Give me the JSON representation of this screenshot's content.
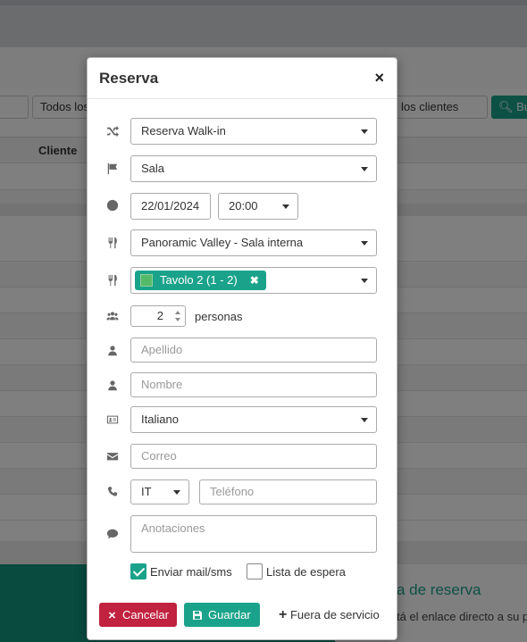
{
  "background": {
    "filter_all": "Todos los",
    "filter_clients": "los clientes",
    "search_button": "Bu",
    "column_client": "Cliente",
    "footer_title": "a de reserva",
    "footer_text": "tá el enlace directo a su p"
  },
  "modal": {
    "title": "Reserva",
    "close_symbol": "×",
    "booking_type": "Reserva Walk-in",
    "area": "Sala",
    "date": "22/01/2024",
    "time": "20:00",
    "room": "Panoramic Valley - Sala interna",
    "table_tag": "Tavolo 2 (1 - 2)",
    "table_tag_remove": "✖",
    "people_count": "2",
    "people_unit": "personas",
    "surname_placeholder": "Apellido",
    "name_placeholder": "Nombre",
    "language": "Italiano",
    "email_placeholder": "Correo",
    "phone_prefix": "IT",
    "phone_placeholder": "Teléfono",
    "notes_placeholder": "Anotaciones",
    "send_mail_label": "Enviar mail/sms",
    "send_mail_checked": true,
    "waitlist_label": "Lista de espera",
    "waitlist_checked": false,
    "cancel_label": "Cancelar",
    "save_label": "Guardar",
    "out_of_service_label": "Fuera de servicio"
  },
  "icons": {
    "booking_type": "shuffle-icon",
    "area": "flag-icon",
    "datetime": "clock-icon",
    "room": "cutlery-icon",
    "table": "cutlery-icon",
    "people": "users-icon",
    "surname": "user-icon",
    "name": "user-icon",
    "language": "id-card-icon",
    "email": "envelope-icon",
    "phone": "phone-icon",
    "notes": "comment-icon",
    "cancel": "times-icon",
    "save": "floppy-icon",
    "out_of_service": "plus-icon"
  },
  "colors": {
    "accent": "#1aa38a",
    "danger": "#c0223f"
  }
}
